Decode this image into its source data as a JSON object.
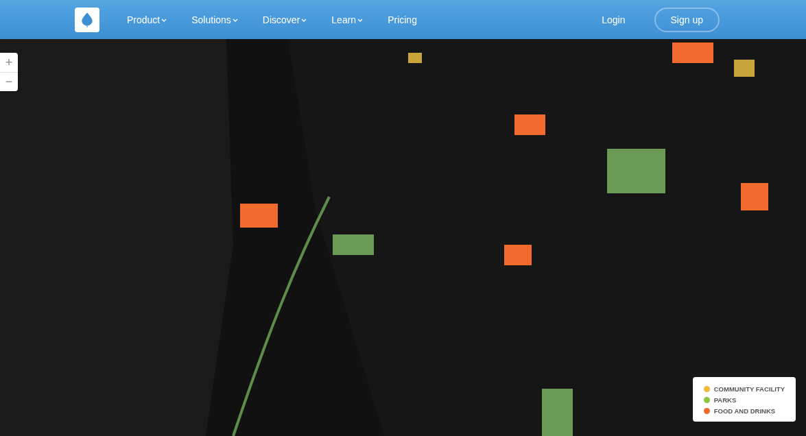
{
  "nav": {
    "items": [
      {
        "label": "Product",
        "dropdown": true
      },
      {
        "label": "Solutions",
        "dropdown": true
      },
      {
        "label": "Discover",
        "dropdown": true
      },
      {
        "label": "Learn",
        "dropdown": true
      },
      {
        "label": "Pricing",
        "dropdown": false
      }
    ],
    "login": "Login",
    "signup": "Sign up"
  },
  "map": {
    "zoom_in": "+",
    "zoom_out": "−",
    "legend": [
      {
        "label": "COMMUNITY FACILITY",
        "color": "#f0b93a"
      },
      {
        "label": "PARKS",
        "color": "#8cc63f"
      },
      {
        "label": "FOOD AND DRINKS",
        "color": "#f26a2e"
      }
    ]
  }
}
